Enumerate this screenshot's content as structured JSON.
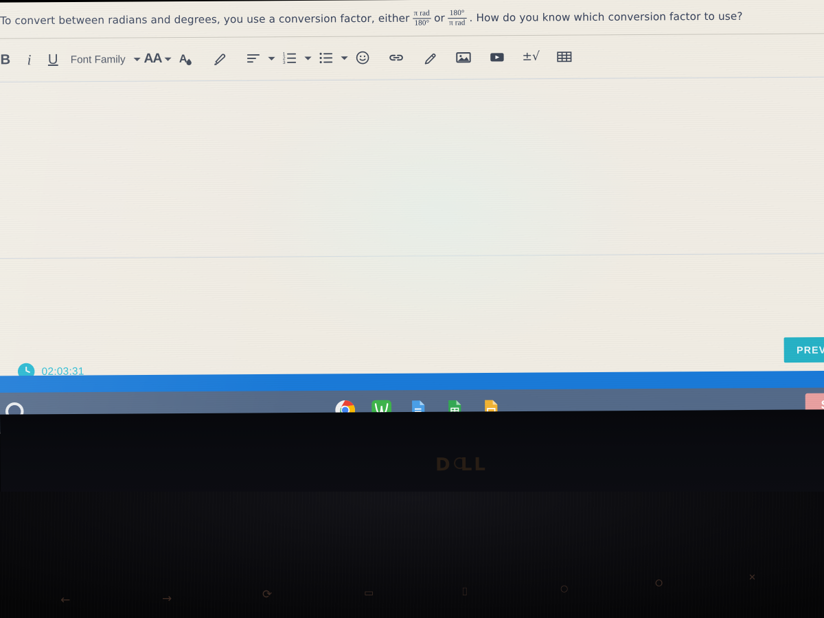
{
  "question": {
    "lead": ". To convert between radians and degrees, you use a conversion factor, either",
    "frac1": {
      "numerator": "π rad",
      "denominator": "180°"
    },
    "connector": "or",
    "frac2": {
      "numerator": "180°",
      "denominator": "π rad"
    },
    "tail": ". How do you know which conversion factor to use?"
  },
  "toolbar": {
    "bold_label": "B",
    "italic_label": "i",
    "underline_label": "U",
    "font_family_label": "Font Family",
    "font_size_label": "AA",
    "items": [
      {
        "name": "bold",
        "label": "B"
      },
      {
        "name": "italic",
        "label": "i"
      },
      {
        "name": "underline",
        "label": "U"
      },
      {
        "name": "font-family",
        "label": "Font Family"
      },
      {
        "name": "font-size",
        "label": "AA"
      },
      {
        "name": "text-color",
        "label": "A"
      },
      {
        "name": "highlighter",
        "label": ""
      },
      {
        "name": "align",
        "label": ""
      },
      {
        "name": "numbered-list",
        "label": ""
      },
      {
        "name": "bulleted-list",
        "label": ""
      },
      {
        "name": "emoji",
        "label": ""
      },
      {
        "name": "link",
        "label": ""
      },
      {
        "name": "draw",
        "label": ""
      },
      {
        "name": "image",
        "label": ""
      },
      {
        "name": "video",
        "label": ""
      },
      {
        "name": "math",
        "label": "±√"
      },
      {
        "name": "table",
        "label": ""
      }
    ]
  },
  "editor": {
    "value": "",
    "placeholder": ""
  },
  "timer": {
    "value": "02:03:31"
  },
  "navigation": {
    "previous_label": "PREVIOUS"
  },
  "shelf": {
    "launcher_label": "",
    "apps": [
      {
        "name": "chrome",
        "label": "Chrome"
      },
      {
        "name": "desmos",
        "label": "Desmos"
      },
      {
        "name": "google-docs",
        "label": "Docs"
      },
      {
        "name": "google-sheets",
        "label": "Sheets"
      },
      {
        "name": "google-slides",
        "label": "Slides"
      }
    ],
    "tray_label": "S"
  },
  "hardware": {
    "brand": "DELL",
    "function_keys": [
      {
        "name": "back",
        "glyph": "←"
      },
      {
        "name": "forward",
        "glyph": "→"
      },
      {
        "name": "reload",
        "glyph": "⟳"
      },
      {
        "name": "fullscreen",
        "glyph": "▭"
      },
      {
        "name": "overview",
        "glyph": "⌷"
      },
      {
        "name": "brightness-down",
        "glyph": "○"
      },
      {
        "name": "brightness-up",
        "glyph": "⭘"
      },
      {
        "name": "mute",
        "glyph": "✕"
      }
    ]
  },
  "colors": {
    "accent_cyan": "#27b2c6",
    "band_blue": "#1a7ad8",
    "shelf_blue": "#546a89",
    "screen_bg": "#f0ece3",
    "text": "#36415a"
  }
}
